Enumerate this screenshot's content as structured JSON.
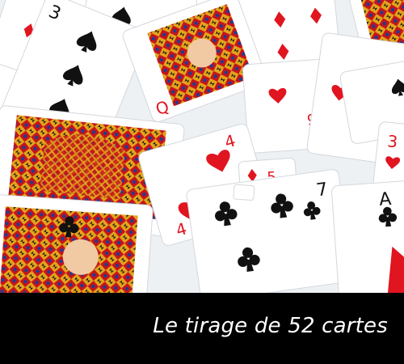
{
  "caption": {
    "text": "Le tirage de 52 cartes"
  },
  "photo": {
    "subject": "scattered-playing-cards",
    "colors": {
      "red_suit": "#e0151f",
      "black_suit": "#111111",
      "card_face": "#ffffff",
      "shadow": "#c9ced4",
      "court_gold": "#e3a41c",
      "court_red": "#c5141c",
      "court_blue": "#1d3f8f"
    }
  }
}
